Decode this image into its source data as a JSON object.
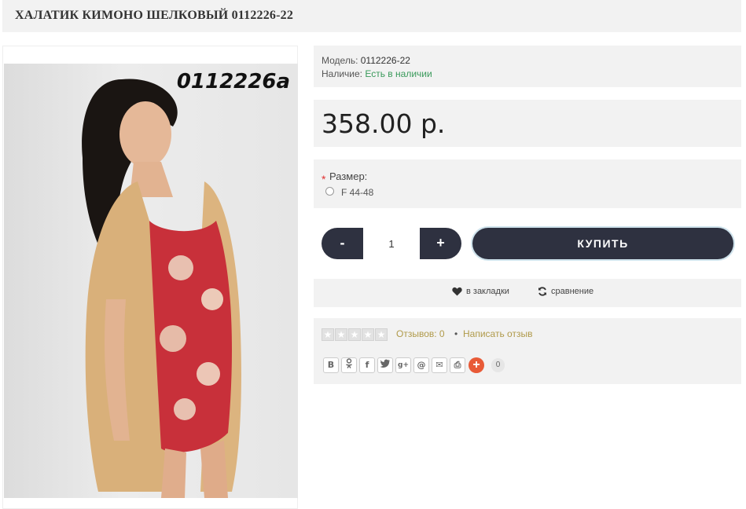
{
  "product": {
    "title": "ХАЛАТИК КИМОНО ШЕЛКОВЫЙ 0112226-22",
    "photo_code": "0112226a",
    "model_label": "Модель:",
    "model_value": "0112226-22",
    "stock_label": "Наличие:",
    "stock_value": "Есть в наличии",
    "price": "358.00 р."
  },
  "options": {
    "required_mark": "*",
    "size_label": "Размер:",
    "size_options": [
      "F 44-48"
    ]
  },
  "cart": {
    "minus_label": "-",
    "quantity": "1",
    "plus_label": "+",
    "buy_label": "КУПИТЬ"
  },
  "actions": {
    "bookmark_label": "в закладки",
    "compare_label": "сравнение"
  },
  "reviews": {
    "rating": 0,
    "reviews_link": "Отзывов: 0",
    "separator": "•",
    "write_link": "Написать отзыв"
  },
  "share": {
    "buttons": [
      "В",
      "ok",
      "f",
      "twitter",
      "g+",
      "@",
      "mail",
      "print"
    ],
    "button_glyphs": [
      "В",
      "ok",
      "f",
      "t",
      "g+",
      "@",
      "✉",
      "⎙"
    ],
    "plus": "+",
    "count": "0"
  },
  "colors": {
    "accent_dark": "#2e3140",
    "panel_bg": "#f2f2f2",
    "stock_green": "#3a9a5b",
    "link_gold": "#b09a4a",
    "share_orange": "#e85a37"
  }
}
